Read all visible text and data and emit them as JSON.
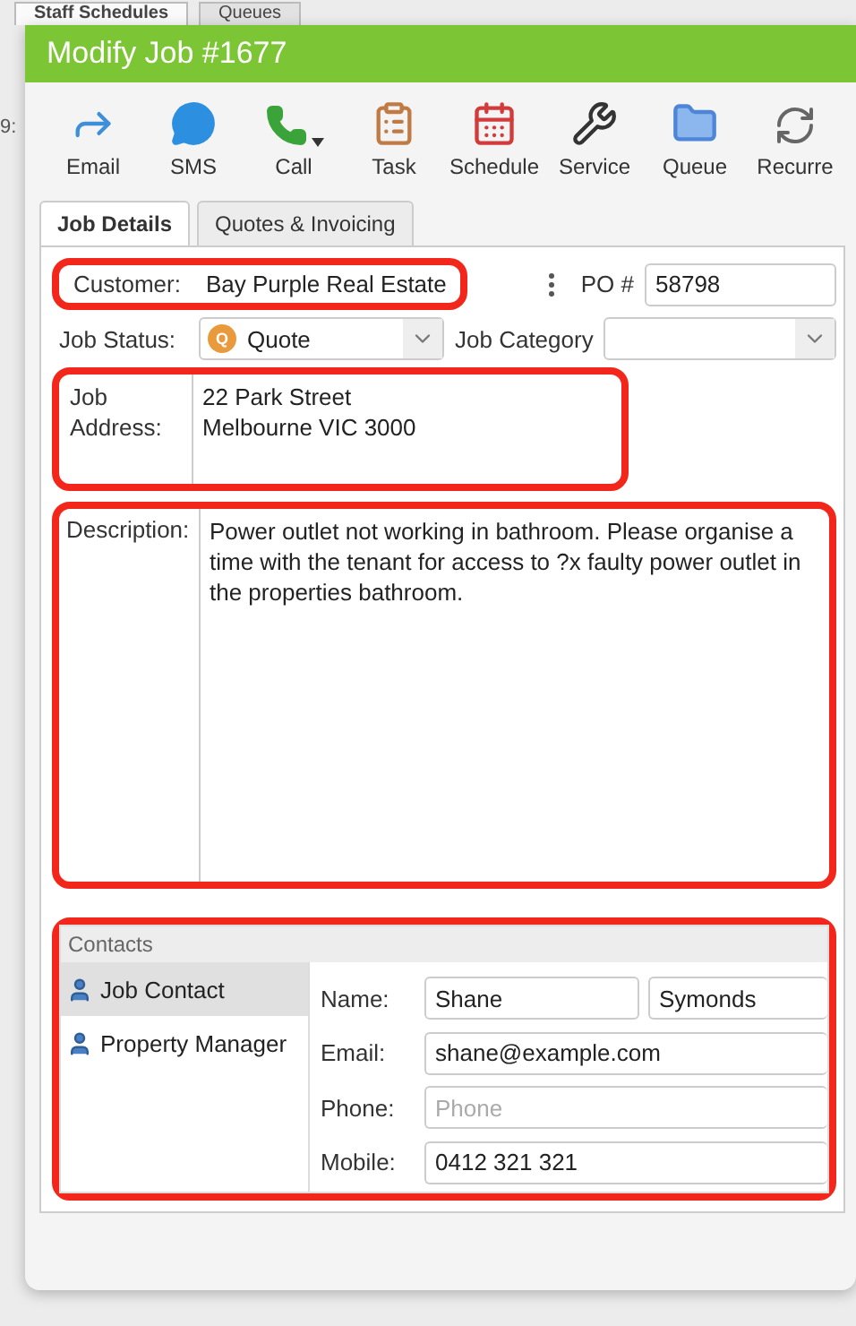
{
  "background_tabs": [
    {
      "label": "Staff Schedules",
      "selected": true
    },
    {
      "label": "Queues",
      "selected": false
    }
  ],
  "background_text": "9:",
  "window": {
    "title": "Modify Job #1677"
  },
  "toolbar": [
    {
      "kind": "email",
      "label": "Email",
      "dropdown": false
    },
    {
      "kind": "sms",
      "label": "SMS",
      "dropdown": false
    },
    {
      "kind": "call",
      "label": "Call",
      "dropdown": true
    },
    {
      "kind": "task",
      "label": "Task",
      "dropdown": false
    },
    {
      "kind": "schedule",
      "label": "Schedule",
      "dropdown": false
    },
    {
      "kind": "service",
      "label": "Service",
      "dropdown": false
    },
    {
      "kind": "queue",
      "label": "Queue",
      "dropdown": false
    },
    {
      "kind": "recurring",
      "label": "Recurre",
      "dropdown": false
    }
  ],
  "tabs": [
    {
      "label": "Job Details",
      "selected": true
    },
    {
      "label": "Quotes & Invoicing",
      "selected": false
    }
  ],
  "customer": {
    "label": "Customer:",
    "value": "Bay Purple Real Estate",
    "highlighted": true
  },
  "po": {
    "label": "PO #",
    "value": "58798"
  },
  "job_status": {
    "label": "Job Status:",
    "badge": "Q",
    "value": "Quote"
  },
  "job_category": {
    "label": "Job Category"
  },
  "job_address": {
    "label_lines": [
      "Job",
      "Address:"
    ],
    "lines": [
      "22 Park Street",
      "Melbourne VIC 3000"
    ],
    "highlighted": true
  },
  "description": {
    "label": "Description:",
    "value": "Power outlet not working in bathroom. Please organise a time with the tenant for access to ?x faulty power outlet in the properties bathroom.",
    "highlighted": true
  },
  "contacts": {
    "title": "Contacts",
    "highlighted": true,
    "list": [
      {
        "label": "Job Contact",
        "selected": true
      },
      {
        "label": "Property Manager",
        "selected": false
      }
    ],
    "name_label": "Name:",
    "first_name": "Shane",
    "last_name": "Symonds",
    "fields": [
      {
        "label": "Email:",
        "value": "shane@example.com"
      },
      {
        "label": "Phone:",
        "placeholder": "Phone"
      },
      {
        "label": "Mobile:",
        "value": "0412 321 321"
      }
    ]
  }
}
